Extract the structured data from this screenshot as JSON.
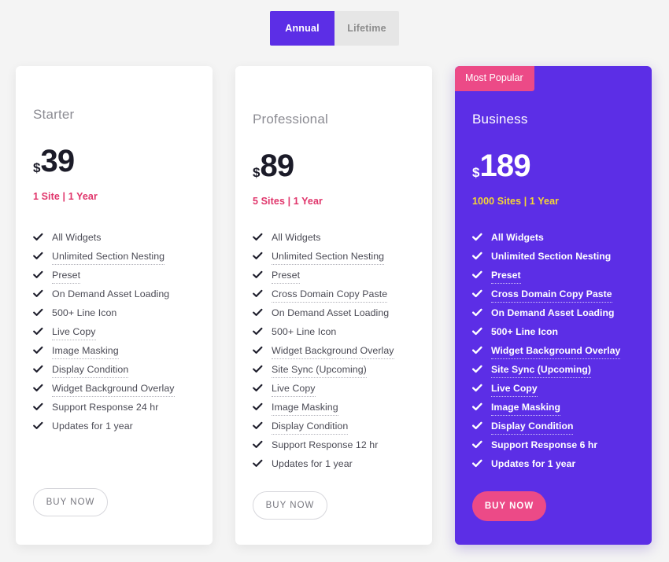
{
  "billing_toggle": {
    "options": [
      {
        "label": "Annual",
        "active": true
      },
      {
        "label": "Lifetime",
        "active": false
      }
    ]
  },
  "colors": {
    "page_background": "#f4f4f4",
    "accent_purple": "#5c2ee6",
    "accent_pink": "#ec4a87",
    "price_note_crimson": "#e0356b",
    "price_note_yellow": "#f6d633",
    "card_white": "#ffffff"
  },
  "plans": [
    {
      "name": "Starter",
      "currency": "$",
      "amount": "39",
      "price_note": "1 Site | 1 Year",
      "badge": null,
      "highlighted": false,
      "buy_label": "BUY NOW",
      "features": [
        {
          "label": "All Widgets",
          "tooltip": false
        },
        {
          "label": "Unlimited Section Nesting",
          "tooltip": true
        },
        {
          "label": "Preset",
          "tooltip": true
        },
        {
          "label": "On Demand Asset Loading",
          "tooltip": false
        },
        {
          "label": "500+ Line Icon",
          "tooltip": false
        },
        {
          "label": "Live Copy",
          "tooltip": true
        },
        {
          "label": "Image Masking",
          "tooltip": true
        },
        {
          "label": "Display Condition",
          "tooltip": true
        },
        {
          "label": "Widget Background Overlay",
          "tooltip": true
        },
        {
          "label": "Support Response 24 hr",
          "tooltip": false
        },
        {
          "label": "Updates for 1 year",
          "tooltip": false
        }
      ]
    },
    {
      "name": "Professional",
      "currency": "$",
      "amount": "89",
      "price_note": "5 Sites | 1 Year",
      "badge": null,
      "highlighted": false,
      "buy_label": "BUY NOW",
      "features": [
        {
          "label": "All Widgets",
          "tooltip": false
        },
        {
          "label": "Unlimited Section Nesting",
          "tooltip": true
        },
        {
          "label": "Preset",
          "tooltip": true
        },
        {
          "label": "Cross Domain Copy Paste",
          "tooltip": true
        },
        {
          "label": "On Demand Asset Loading",
          "tooltip": false
        },
        {
          "label": "500+ Line Icon",
          "tooltip": false
        },
        {
          "label": "Widget Background Overlay",
          "tooltip": true
        },
        {
          "label": "Site Sync (Upcoming)",
          "tooltip": true
        },
        {
          "label": "Live Copy",
          "tooltip": true
        },
        {
          "label": "Image Masking",
          "tooltip": true
        },
        {
          "label": "Display Condition",
          "tooltip": true
        },
        {
          "label": "Support Response 12 hr",
          "tooltip": false
        },
        {
          "label": "Updates for 1 year",
          "tooltip": false
        }
      ]
    },
    {
      "name": "Business",
      "currency": "$",
      "amount": "189",
      "price_note": "1000 Sites | 1 Year",
      "badge": "Most Popular",
      "highlighted": true,
      "buy_label": "BUY NOW",
      "features": [
        {
          "label": "All Widgets",
          "tooltip": false
        },
        {
          "label": "Unlimited Section Nesting",
          "tooltip": false
        },
        {
          "label": "Preset",
          "tooltip": true
        },
        {
          "label": "Cross Domain Copy Paste",
          "tooltip": true
        },
        {
          "label": "On Demand Asset Loading",
          "tooltip": false
        },
        {
          "label": "500+ Line Icon",
          "tooltip": false
        },
        {
          "label": "Widget Background Overlay",
          "tooltip": true
        },
        {
          "label": "Site Sync (Upcoming)",
          "tooltip": true
        },
        {
          "label": "Live Copy",
          "tooltip": true
        },
        {
          "label": "Image Masking",
          "tooltip": true
        },
        {
          "label": "Display Condition",
          "tooltip": true
        },
        {
          "label": "Support Response 6 hr",
          "tooltip": false
        },
        {
          "label": "Updates for 1 year",
          "tooltip": false
        }
      ]
    }
  ]
}
